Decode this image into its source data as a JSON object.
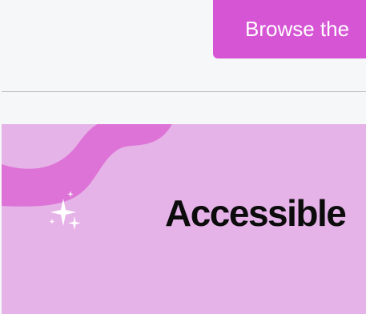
{
  "header": {
    "browse_label": "Browse the"
  },
  "banner": {
    "title": "Accessible"
  },
  "colors": {
    "button_bg": "#d655d5",
    "banner_bg": "#e6b3e8",
    "wave": "#dd73d6",
    "page_bg": "#f6f7f9"
  }
}
